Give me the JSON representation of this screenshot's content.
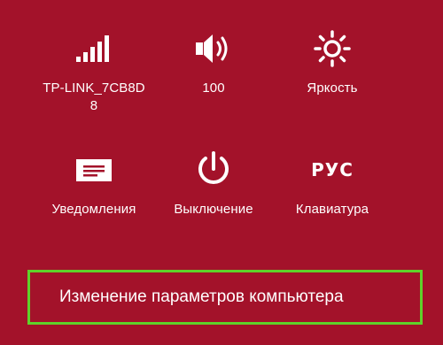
{
  "panel": {
    "background": "#a3122a",
    "highlight_border": "#5fd22a"
  },
  "tiles": {
    "network": {
      "icon": "signal-bars-icon",
      "label": "TP-LINK_7CB8D8"
    },
    "volume": {
      "icon": "speaker-icon",
      "label": "100"
    },
    "brightness": {
      "icon": "sun-icon",
      "label": "Яркость"
    },
    "notifications": {
      "icon": "message-icon",
      "label": "Уведомления"
    },
    "power": {
      "icon": "power-icon",
      "label": "Выключение"
    },
    "keyboard": {
      "icon_text": "РУС",
      "label": "Клавиатура"
    }
  },
  "change_settings": {
    "label": "Изменение параметров компьютера"
  }
}
